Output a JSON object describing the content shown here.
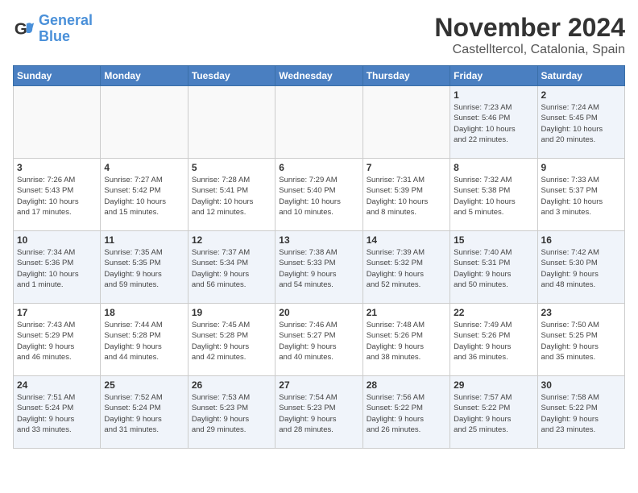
{
  "logo": {
    "line1": "General",
    "line2": "Blue"
  },
  "title": "November 2024",
  "location": "Castelltercol, Catalonia, Spain",
  "weekdays": [
    "Sunday",
    "Monday",
    "Tuesday",
    "Wednesday",
    "Thursday",
    "Friday",
    "Saturday"
  ],
  "weeks": [
    [
      {
        "day": "",
        "info": ""
      },
      {
        "day": "",
        "info": ""
      },
      {
        "day": "",
        "info": ""
      },
      {
        "day": "",
        "info": ""
      },
      {
        "day": "",
        "info": ""
      },
      {
        "day": "1",
        "info": "Sunrise: 7:23 AM\nSunset: 5:46 PM\nDaylight: 10 hours\nand 22 minutes."
      },
      {
        "day": "2",
        "info": "Sunrise: 7:24 AM\nSunset: 5:45 PM\nDaylight: 10 hours\nand 20 minutes."
      }
    ],
    [
      {
        "day": "3",
        "info": "Sunrise: 7:26 AM\nSunset: 5:43 PM\nDaylight: 10 hours\nand 17 minutes."
      },
      {
        "day": "4",
        "info": "Sunrise: 7:27 AM\nSunset: 5:42 PM\nDaylight: 10 hours\nand 15 minutes."
      },
      {
        "day": "5",
        "info": "Sunrise: 7:28 AM\nSunset: 5:41 PM\nDaylight: 10 hours\nand 12 minutes."
      },
      {
        "day": "6",
        "info": "Sunrise: 7:29 AM\nSunset: 5:40 PM\nDaylight: 10 hours\nand 10 minutes."
      },
      {
        "day": "7",
        "info": "Sunrise: 7:31 AM\nSunset: 5:39 PM\nDaylight: 10 hours\nand 8 minutes."
      },
      {
        "day": "8",
        "info": "Sunrise: 7:32 AM\nSunset: 5:38 PM\nDaylight: 10 hours\nand 5 minutes."
      },
      {
        "day": "9",
        "info": "Sunrise: 7:33 AM\nSunset: 5:37 PM\nDaylight: 10 hours\nand 3 minutes."
      }
    ],
    [
      {
        "day": "10",
        "info": "Sunrise: 7:34 AM\nSunset: 5:36 PM\nDaylight: 10 hours\nand 1 minute."
      },
      {
        "day": "11",
        "info": "Sunrise: 7:35 AM\nSunset: 5:35 PM\nDaylight: 9 hours\nand 59 minutes."
      },
      {
        "day": "12",
        "info": "Sunrise: 7:37 AM\nSunset: 5:34 PM\nDaylight: 9 hours\nand 56 minutes."
      },
      {
        "day": "13",
        "info": "Sunrise: 7:38 AM\nSunset: 5:33 PM\nDaylight: 9 hours\nand 54 minutes."
      },
      {
        "day": "14",
        "info": "Sunrise: 7:39 AM\nSunset: 5:32 PM\nDaylight: 9 hours\nand 52 minutes."
      },
      {
        "day": "15",
        "info": "Sunrise: 7:40 AM\nSunset: 5:31 PM\nDaylight: 9 hours\nand 50 minutes."
      },
      {
        "day": "16",
        "info": "Sunrise: 7:42 AM\nSunset: 5:30 PM\nDaylight: 9 hours\nand 48 minutes."
      }
    ],
    [
      {
        "day": "17",
        "info": "Sunrise: 7:43 AM\nSunset: 5:29 PM\nDaylight: 9 hours\nand 46 minutes."
      },
      {
        "day": "18",
        "info": "Sunrise: 7:44 AM\nSunset: 5:28 PM\nDaylight: 9 hours\nand 44 minutes."
      },
      {
        "day": "19",
        "info": "Sunrise: 7:45 AM\nSunset: 5:28 PM\nDaylight: 9 hours\nand 42 minutes."
      },
      {
        "day": "20",
        "info": "Sunrise: 7:46 AM\nSunset: 5:27 PM\nDaylight: 9 hours\nand 40 minutes."
      },
      {
        "day": "21",
        "info": "Sunrise: 7:48 AM\nSunset: 5:26 PM\nDaylight: 9 hours\nand 38 minutes."
      },
      {
        "day": "22",
        "info": "Sunrise: 7:49 AM\nSunset: 5:26 PM\nDaylight: 9 hours\nand 36 minutes."
      },
      {
        "day": "23",
        "info": "Sunrise: 7:50 AM\nSunset: 5:25 PM\nDaylight: 9 hours\nand 35 minutes."
      }
    ],
    [
      {
        "day": "24",
        "info": "Sunrise: 7:51 AM\nSunset: 5:24 PM\nDaylight: 9 hours\nand 33 minutes."
      },
      {
        "day": "25",
        "info": "Sunrise: 7:52 AM\nSunset: 5:24 PM\nDaylight: 9 hours\nand 31 minutes."
      },
      {
        "day": "26",
        "info": "Sunrise: 7:53 AM\nSunset: 5:23 PM\nDaylight: 9 hours\nand 29 minutes."
      },
      {
        "day": "27",
        "info": "Sunrise: 7:54 AM\nSunset: 5:23 PM\nDaylight: 9 hours\nand 28 minutes."
      },
      {
        "day": "28",
        "info": "Sunrise: 7:56 AM\nSunset: 5:22 PM\nDaylight: 9 hours\nand 26 minutes."
      },
      {
        "day": "29",
        "info": "Sunrise: 7:57 AM\nSunset: 5:22 PM\nDaylight: 9 hours\nand 25 minutes."
      },
      {
        "day": "30",
        "info": "Sunrise: 7:58 AM\nSunset: 5:22 PM\nDaylight: 9 hours\nand 23 minutes."
      }
    ]
  ]
}
